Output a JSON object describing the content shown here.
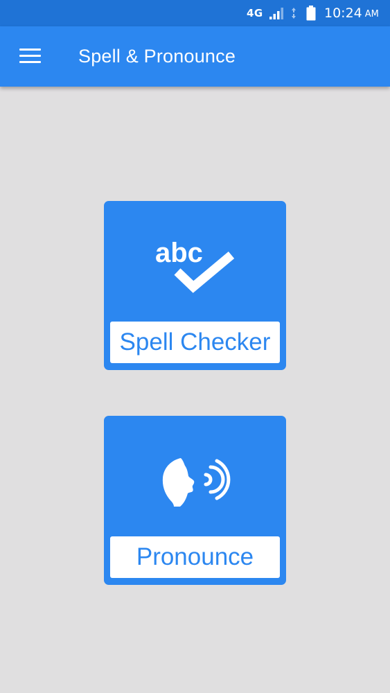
{
  "status_bar": {
    "network": "4G",
    "time": "10:24",
    "ampm": "AM",
    "icons": [
      "signal-icon",
      "data-arrows-icon",
      "battery-icon"
    ]
  },
  "app_bar": {
    "title": "Spell & Pronounce",
    "menu_icon": "hamburger-menu-icon"
  },
  "cards": {
    "spell_checker": {
      "label": "Spell Checker",
      "icon_text": "abc",
      "icon": "spell-check-icon"
    },
    "pronounce": {
      "label": "Pronounce",
      "icon": "speaking-head-icon"
    }
  },
  "colors": {
    "status_bar": "#1f73d6",
    "primary": "#2c87f0",
    "background": "#e0dfe0",
    "label_bg": "#ffffff"
  }
}
